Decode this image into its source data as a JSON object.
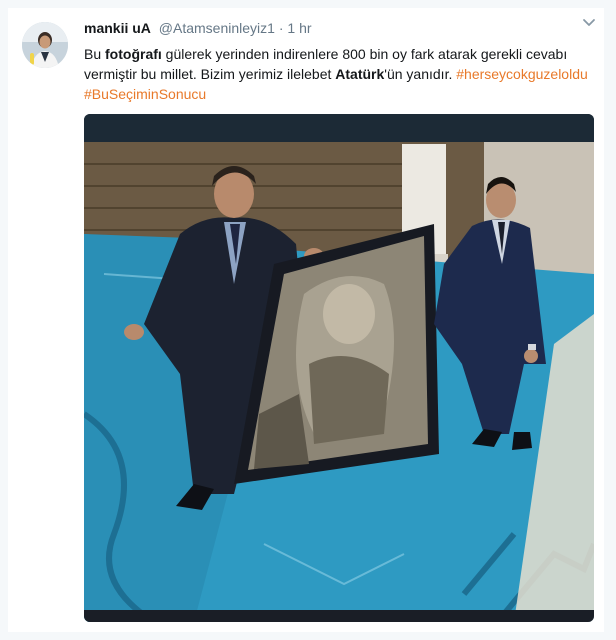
{
  "tweet": {
    "author_name": "mankii uA",
    "author_handle": "@Atamseninleyiz1",
    "separator": "·",
    "time": "1 hr",
    "text": {
      "p1": "Bu ",
      "b1": "fotoğrafı",
      "p2": " gülerek yerinden indirenlere 800 bin oy fark atarak gerekli cevabı vermiştir bu millet. Bizim yerimiz ilelebet ",
      "b2": "Atatürk",
      "p3": "'ün yanıdır. ",
      "hashtag1": "#herseycokguzeloldu",
      "hashtag2": "#BuSeçiminSonucu"
    },
    "icons": {
      "menu": "chevron-down-icon",
      "avatar": "profile-avatar"
    },
    "colors": {
      "hashtag": "#e8792a",
      "name": "#14171a",
      "meta": "#657786",
      "carpet": "#2e9ac2"
    }
  }
}
